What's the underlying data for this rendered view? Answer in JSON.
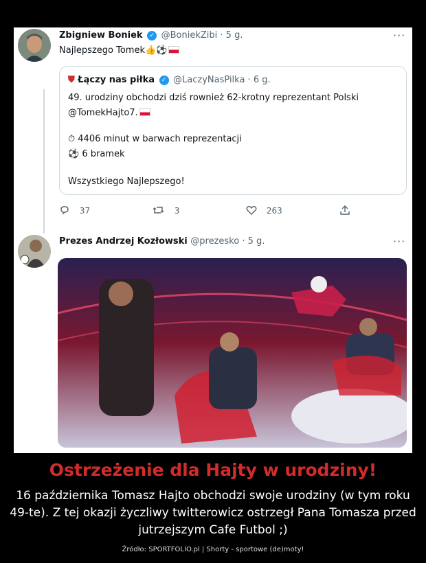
{
  "tweet1": {
    "author": "Zbigniew Boniek",
    "handle": "@BoniekZibi · 5 g.",
    "text": "Najlepszego Tomek👍⚽",
    "more": "···"
  },
  "quote": {
    "author": "Łączy nas piłka",
    "handle": "@LaczyNasPilka · 6 g.",
    "line1": "49. urodziny obchodzi dziś rownież 62-krotny reprezentant Polski",
    "line2": "@TomekHajto7.",
    "line3": "⏱ 4406 minut w barwach reprezentacji",
    "line4": "⚽ 6 bramek",
    "line5": "Wszystkiego Najlepszego!"
  },
  "actions": {
    "replies": "37",
    "retweets": "3",
    "likes": "263"
  },
  "tweet2": {
    "author": "Prezes Andrzej Kozłowski",
    "handle": "@prezesko · 5 g.",
    "more": "···"
  },
  "caption": {
    "title": "Ostrzeżenie dla Hajty w urodziny!",
    "body": "16 października Tomasz Hajto obchodzi swoje urodziny (w tym roku 49-te). Z tej okazji życzliwy twitterowicz ostrzegł Pana Tomasza przed jutrzejszym Cafe Futbol ;)",
    "footer": "Źródło: SPORTFOLIO.pl | Shorty - sportowe (de)moty!"
  },
  "colors": {
    "accent": "#1d9bf0",
    "title": "#d12c2c"
  }
}
